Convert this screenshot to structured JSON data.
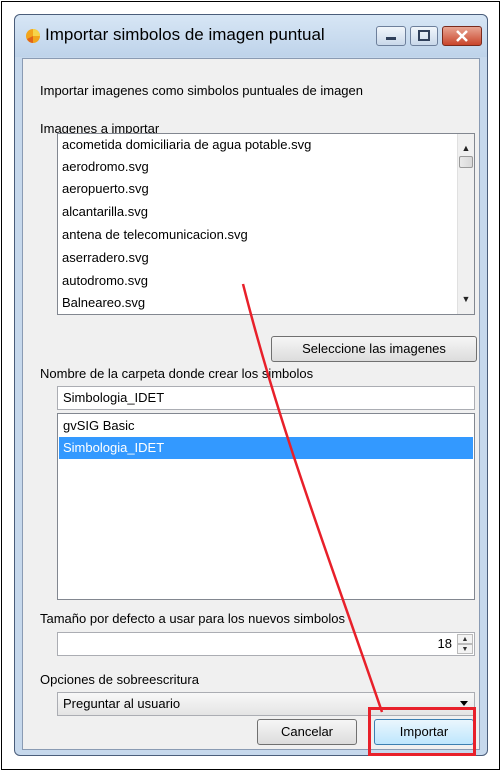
{
  "window": {
    "title": "Importar simbolos de imagen puntual",
    "title_icon": "gvsig-icon"
  },
  "dialog": {
    "description": "Importar imagenes como simbolos puntuales de imagen",
    "images_label": "Imagenes a importar",
    "images": [
      "acometida domiciliaria de agua potable.svg",
      "aerodromo.svg",
      "aeropuerto.svg",
      "alcantarilla.svg",
      "antena de telecomunicacion.svg",
      "aserradero.svg",
      "autodromo.svg",
      "Balneareo.svg"
    ],
    "select_images_button": "Seleccione las imagenes",
    "folder_label": "Nombre de la carpeta donde crear los simbolos",
    "folder_name_value": "Simbologia_IDET",
    "folders": [
      "gvSIG Basic",
      "Simbologia_IDET"
    ],
    "selected_folder": "Simbologia_IDET",
    "size_label": "Tamaño por defecto a usar para los nuevos simbolos",
    "size_value": "18",
    "overwrite_label": "Opciones de sobreescritura",
    "overwrite_value": "Preguntar al usuario",
    "cancel_button": "Cancelar",
    "import_button": "Importar"
  },
  "colors": {
    "selection": "#3399ff",
    "annotation": "#e8202a"
  }
}
